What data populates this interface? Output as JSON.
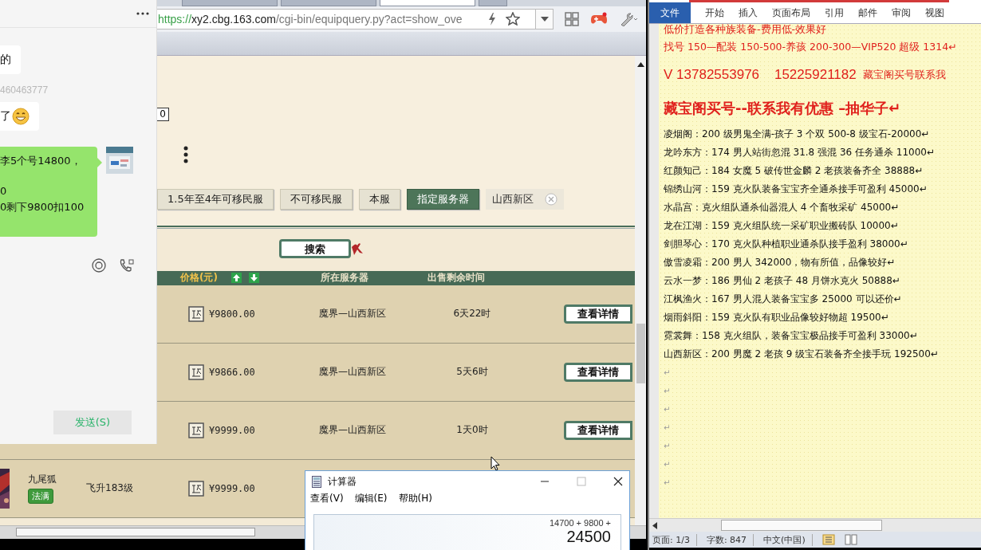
{
  "chat": {
    "messages": [
      {
        "kind": "incoming",
        "text": "的",
        "emoji": false
      },
      {
        "kind": "meta",
        "text": "460463777"
      },
      {
        "kind": "incoming",
        "text": "了",
        "emoji": true
      },
      {
        "kind": "outgoing",
        "lines": [
          "李5个号14800，",
          "0",
          "0剩下9800扣100"
        ]
      }
    ],
    "send_button": "发送(S)"
  },
  "browser": {
    "tabs": [
      {
        "selected": false
      },
      {
        "selected": false
      },
      {
        "selected": true
      },
      {
        "selected": false
      }
    ],
    "url": {
      "scheme": "https://",
      "host": "xy2.cbg.163.com",
      "path": "/cgi-bin/equipquery.py?act=show_ove"
    },
    "page_field": "0",
    "filters": [
      {
        "label": "1.5年至4年可移民服",
        "selected": false
      },
      {
        "label": "不可移民服",
        "selected": false
      },
      {
        "label": "本服",
        "selected": false
      },
      {
        "label": "指定服务器",
        "selected": true
      }
    ],
    "region_tag": "山西新区",
    "search_button": "搜索",
    "table": {
      "columns": [
        "价格(元)",
        "所在服务器",
        "出售剩余时间"
      ],
      "rows": [
        {
          "price": "¥9800.00",
          "server": "魔界—山西新区",
          "time": "6天22时",
          "action": "查看详情"
        },
        {
          "price": "¥9866.00",
          "server": "魔界—山西新区",
          "time": "5天6时",
          "action": "查看详情"
        },
        {
          "price": "¥9999.00",
          "server": "魔界—山西新区",
          "time": "1天0时",
          "action": "查看详情"
        },
        {
          "name": "九尾狐",
          "badge": "法满",
          "level": "飞升183级",
          "price": "¥9999.00"
        }
      ]
    }
  },
  "word": {
    "tabs": [
      {
        "label": "文件",
        "selected": true
      },
      {
        "label": "开始",
        "selected": false
      },
      {
        "label": "插入",
        "selected": false
      },
      {
        "label": "页面布局",
        "selected": false
      },
      {
        "label": "引用",
        "selected": false
      },
      {
        "label": "邮件",
        "selected": false
      },
      {
        "label": "审阅",
        "selected": false
      },
      {
        "label": "视图",
        "selected": false
      }
    ],
    "lines": [
      {
        "kind": "promo",
        "text": "低价打造各种族装备-费用低-效果好"
      },
      {
        "kind": "promo",
        "text": "找号 150—配装 150-500-养孩 200-300—VIP520 超级 1314↵"
      },
      {
        "kind": "contact",
        "numbers": "V 13782553976    15225921182",
        "label": "藏宝阁买号联系我"
      },
      {
        "kind": "headline",
        "text": "藏宝阁买号--联系我有优惠 –抽华子↵"
      },
      {
        "kind": "listing",
        "text": "凌烟阁：200 级男鬼全满-孩子 3 个双 500-8 级宝石-20000↵"
      },
      {
        "kind": "listing",
        "text": "龙吟东方：174 男人站街忽混 31.8 强混 36 任务通杀 11000↵"
      },
      {
        "kind": "listing",
        "text": "红颜知己：184 女魔 5 破传世金麟 2 老孩装备齐全 38888↵"
      },
      {
        "kind": "listing",
        "text": "锦绣山河：159 克火队装备宝宝齐全通杀接手可盈利 45000↵"
      },
      {
        "kind": "listing",
        "text": "水晶宫：克火组队通杀仙器混人 4 个畜牧采矿 45000↵"
      },
      {
        "kind": "listing",
        "text": "龙在江湖：159 克火组队统一采矿职业搬砖队 10000↵"
      },
      {
        "kind": "listing",
        "text": "剑胆琴心：170 克火队种植职业通杀队接手盈利 38000↵"
      },
      {
        "kind": "listing",
        "text": "傲雪凌霜：200 男人 342000，物有所值，品像较好↵"
      },
      {
        "kind": "listing",
        "text": "云水一梦：186 男仙 2 老孩子 48 月饼水克火 50888↵"
      },
      {
        "kind": "listing",
        "text": "江枫渔火：167 男人混人装备宝宝多 25000 可以还价↵"
      },
      {
        "kind": "listing",
        "text": "烟雨斜阳：159 克火队有职业品像较好物超 19500↵"
      },
      {
        "kind": "listing",
        "text": "霓裳舞：158 克火组队，装备宝宝极品接手可盈利 33000↵"
      },
      {
        "kind": "listing",
        "text": "山西新区：200 男魔 2 老孩 9 级宝石装备齐全接手玩 192500↵"
      },
      {
        "kind": "empty",
        "text": "↵"
      },
      {
        "kind": "empty",
        "text": "↵"
      },
      {
        "kind": "empty",
        "text": "↵"
      },
      {
        "kind": "empty",
        "text": "↵"
      },
      {
        "kind": "empty",
        "text": "↵"
      },
      {
        "kind": "empty",
        "text": "↵"
      },
      {
        "kind": "empty",
        "text": "↵"
      }
    ],
    "status": [
      "页面: 1/3",
      "字数: 847",
      "中文(中国)"
    ]
  },
  "calculator": {
    "title": "计算器",
    "menu": [
      "查看(V)",
      "编辑(E)",
      "帮助(H)"
    ],
    "expression": "14700 + 9800 +",
    "result": "24500"
  }
}
